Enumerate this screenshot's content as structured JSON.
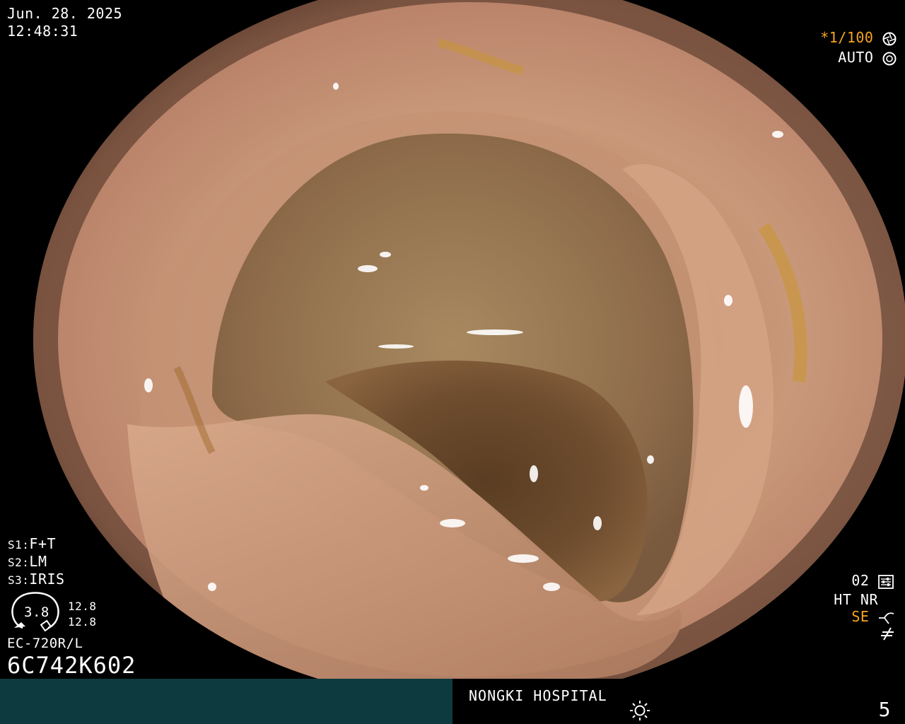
{
  "header": {
    "date": "Jun. 28. 2025",
    "time": "12:48:31"
  },
  "camera": {
    "shutter": "*1/100",
    "shutter_icon": "aperture-icon",
    "iris_mode": "AUTO",
    "iris_icon": "iris-icon"
  },
  "settings": {
    "s1_label": "S1:",
    "s1_value": "F+T",
    "s2_label": "S2:",
    "s2_value": "LM",
    "s3_label": "S3:",
    "s3_value": "IRIS"
  },
  "gauge": {
    "center_value": "3.8",
    "top_value": "12.8",
    "bottom_value": "12.8"
  },
  "scope": {
    "model": "EC-720R/L",
    "serial": "6C742K602"
  },
  "right_status": {
    "line1": "02",
    "line1_icon": "settings-sliders-icon",
    "line2": "HT NR",
    "line3": "SE",
    "line3_icon": "structure-enhance-icon",
    "line4_icon": "freeze-off-icon"
  },
  "footer": {
    "hospital": "NONGKI HOSPITAL",
    "brightness_icon": "sun-icon",
    "page": "5"
  },
  "colors": {
    "osd_text": "#ffffff",
    "osd_accent": "#f7a51d",
    "bottom_left_bg": "#0d3a3f",
    "background": "#000000"
  }
}
